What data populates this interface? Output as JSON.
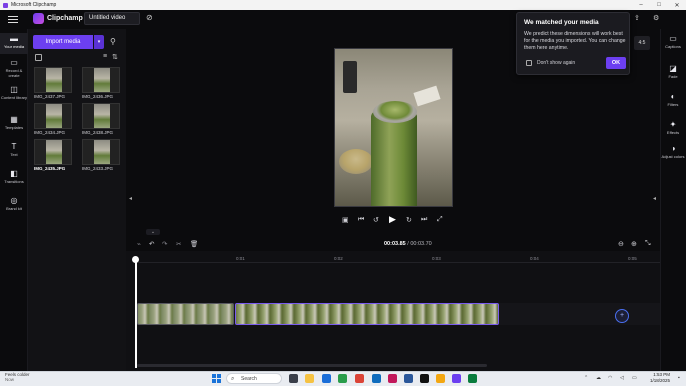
{
  "window": {
    "title": "Microsoft Clipchamp",
    "controls": [
      "minimize",
      "maximize",
      "close"
    ]
  },
  "header": {
    "brand": "Clipchamp",
    "project_title": "Untitled video"
  },
  "leftnav": {
    "items": [
      {
        "label": "Your media",
        "icon": "folder-icon"
      },
      {
        "label": "Record & create",
        "icon": "camera-icon"
      },
      {
        "label": "Content library",
        "icon": "library-icon"
      },
      {
        "label": "Templates",
        "icon": "templates-icon"
      },
      {
        "label": "Text",
        "icon": "text-icon"
      },
      {
        "label": "Transitions",
        "icon": "transitions-icon"
      },
      {
        "label": "Brand kit",
        "icon": "brand-icon"
      }
    ]
  },
  "media": {
    "import_label": "Import media",
    "files": [
      {
        "name": "IMG_2437.JPG",
        "bold": false
      },
      {
        "name": "IMG_2436.JPG",
        "bold": false
      },
      {
        "name": "IMG_2434.JPG",
        "bold": false
      },
      {
        "name": "IMG_2438.JPG",
        "bold": false
      },
      {
        "name": "IMG_2435.JPG",
        "bold": true
      },
      {
        "name": "IMG_2433.JPG",
        "bold": false
      }
    ]
  },
  "popup": {
    "title": "We matched your media",
    "body": "We predict these dimensions will work best for the media you imported. You can change them here anytime.",
    "checkbox_label": "Don't show again",
    "ok_label": "OK"
  },
  "preview": {
    "aspect_ratio": "4:5"
  },
  "righttools": {
    "items": [
      {
        "label": "Captions",
        "icon": "captions-icon"
      },
      {
        "label": "Fade",
        "icon": "fade-icon"
      },
      {
        "label": "Filters",
        "icon": "filters-icon"
      },
      {
        "label": "Effects",
        "icon": "effects-icon"
      },
      {
        "label": "Adjust colors",
        "icon": "adjust-colors-icon"
      }
    ]
  },
  "timeline": {
    "current_time": "00:03.85",
    "separator": " / ",
    "total_time": "00:03.70",
    "ruler": [
      "0",
      "0:01",
      "0:02",
      "0:03",
      "0:04",
      "0:05"
    ]
  },
  "taskbar": {
    "weather_title": "Feels colder",
    "weather_sub": "Now",
    "search_placeholder": "Search",
    "time": "1:53 PM",
    "date": "1/18/2025"
  },
  "colors": {
    "accent": "#6c3ff0",
    "selected_clip_border": "#7a5cf0"
  }
}
